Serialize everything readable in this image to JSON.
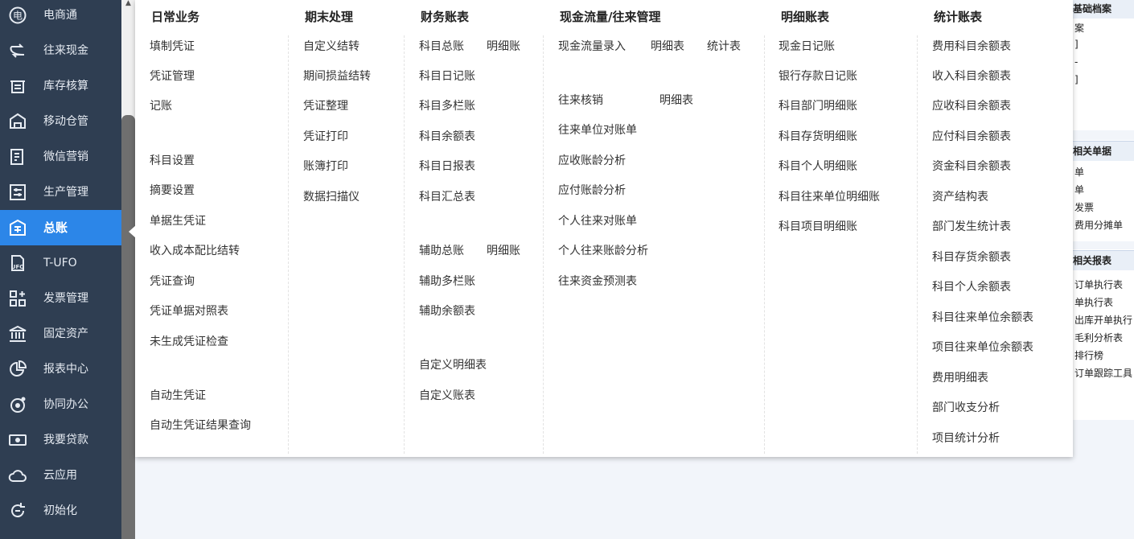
{
  "sidebar": {
    "items": [
      {
        "label": "电商通",
        "icon": "ecommerce-icon"
      },
      {
        "label": "往来现金",
        "icon": "transfer-icon"
      },
      {
        "label": "库存核算",
        "icon": "inventory-icon"
      },
      {
        "label": "移动仓管",
        "icon": "mobile-warehouse-icon"
      },
      {
        "label": "微信营销",
        "icon": "wechat-marketing-icon"
      },
      {
        "label": "生产管理",
        "icon": "production-icon"
      },
      {
        "label": "总账",
        "icon": "ledger-icon",
        "active": true
      },
      {
        "label": "T-UFO",
        "icon": "ufo-icon"
      },
      {
        "label": "发票管理",
        "icon": "invoice-icon"
      },
      {
        "label": "固定资产",
        "icon": "bank-icon"
      },
      {
        "label": "报表中心",
        "icon": "report-pie-icon"
      },
      {
        "label": "协同办公",
        "icon": "collaboration-icon"
      },
      {
        "label": "我要贷款",
        "icon": "loan-icon"
      },
      {
        "label": "云应用",
        "icon": "cloud-icon"
      },
      {
        "label": "初始化",
        "icon": "init-icon"
      }
    ],
    "accent": "#2c86e8",
    "background": "#2f3e52"
  },
  "menu": {
    "columns": {
      "daily": {
        "title": "日常业务",
        "items": [
          "填制凭证",
          "凭证管理",
          "记账",
          "科目设置",
          "摘要设置",
          "单据生凭证",
          "收入成本配比结转",
          "凭证查询",
          "凭证单据对照表",
          "未生成凭证检查",
          "自动生凭证",
          "自动生凭证结果查询"
        ]
      },
      "period_end": {
        "title": "期末处理",
        "items": [
          "自定义结转",
          "期间损益结转",
          "凭证整理",
          "凭证打印",
          "账簿打印",
          "数据扫描仪"
        ]
      },
      "finance_books": {
        "title": "财务账表",
        "items": [
          "科目总账",
          "明细账",
          "科目日记账",
          "科目多栏账",
          "科目余额表",
          "科目日报表",
          "科目汇总表",
          "辅助总账",
          "明细账",
          "辅助多栏账",
          "辅助余额表",
          "自定义明细表",
          "自定义账表"
        ]
      },
      "cashflow": {
        "title": "现金流量/往来管理",
        "items": [
          "现金流量录入",
          "明细表",
          "统计表",
          "往来核销",
          "明细表",
          "往来单位对账单",
          "应收账龄分析",
          "应付账龄分析",
          "个人往来对账单",
          "个人往来账龄分析",
          "往来资金预测表"
        ]
      },
      "detail_books": {
        "title": "明细账表",
        "items": [
          "现金日记账",
          "银行存款日记账",
          "科目部门明细账",
          "科目存货明细账",
          "科目个人明细账",
          "科目往来单位明细账",
          "科目项目明细账"
        ]
      },
      "statistics": {
        "title": "统计账表",
        "items": [
          "费用科目余额表",
          "收入科目余额表",
          "应收科目余额表",
          "应付科目余额表",
          "资金科目余额表",
          "资产结构表",
          "部门发生统计表",
          "科目存货余额表",
          "科目个人余额表",
          "科目往来单位余额表",
          "项目往来单位余额表",
          "费用明细表",
          "部门收支分析",
          "项目统计分析"
        ]
      }
    }
  },
  "right_panel": {
    "section1": {
      "title": "基础档案",
      "items": [
        "案",
        "]",
        "-",
        "]"
      ]
    },
    "section2": {
      "title": "相关单据",
      "items": [
        "单",
        "单",
        "发票",
        "费用分摊单"
      ]
    },
    "section3": {
      "title": "相关报表",
      "items": [
        "订单执行表",
        "单执行表",
        "出库开单执行",
        "毛利分析表",
        "排行榜",
        "订单跟踪工具"
      ]
    }
  }
}
